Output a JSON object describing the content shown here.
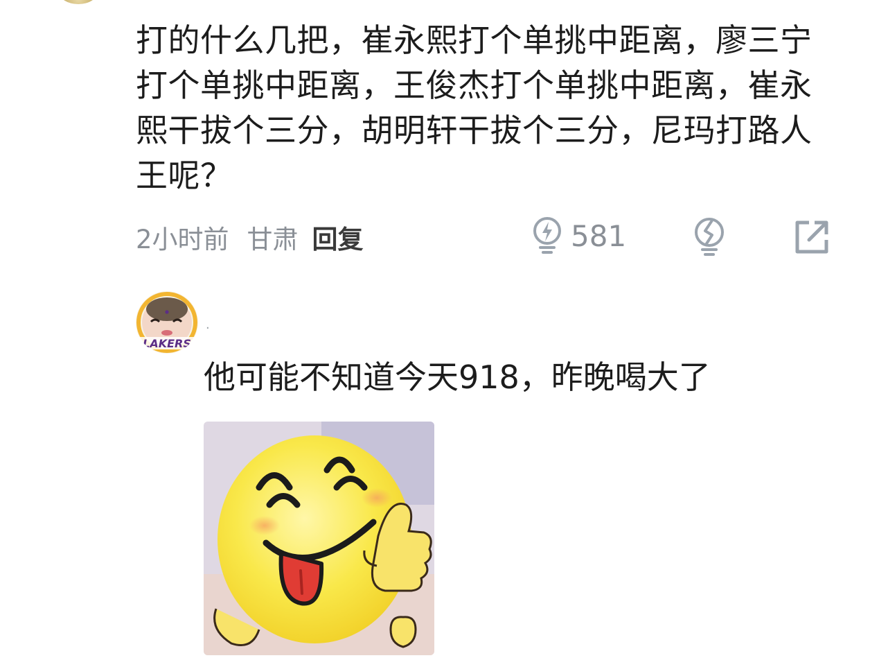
{
  "comment": {
    "text": "打的什么几把，崔永熙打个单挑中距离，廖三宁打个单挑中距离，王俊杰打个单挑中距离，崔永熙干拔个三分，胡明轩干拔个三分，尼玛打路人王呢？",
    "time": "2小时前",
    "location": "甘肃",
    "reply_label": "回复",
    "like_count": "581",
    "icons": {
      "like": "lightbulb-bolt-icon",
      "dislike": "broken-lightbulb-icon",
      "share": "share-arrow-icon"
    }
  },
  "reply_comment": {
    "avatar_badge_text": "LAKERS",
    "username": "·",
    "text": "他可能不知道今天918，昨晚喝大了",
    "sticker": "grinning-thumbs-up-sticker"
  },
  "colors": {
    "text_main": "#1c1c1c",
    "text_meta": "#8a8f96",
    "icon_gray": "#9aa3ad",
    "lakers_purple": "#5b2d86",
    "lakers_gold": "#f2b531"
  }
}
